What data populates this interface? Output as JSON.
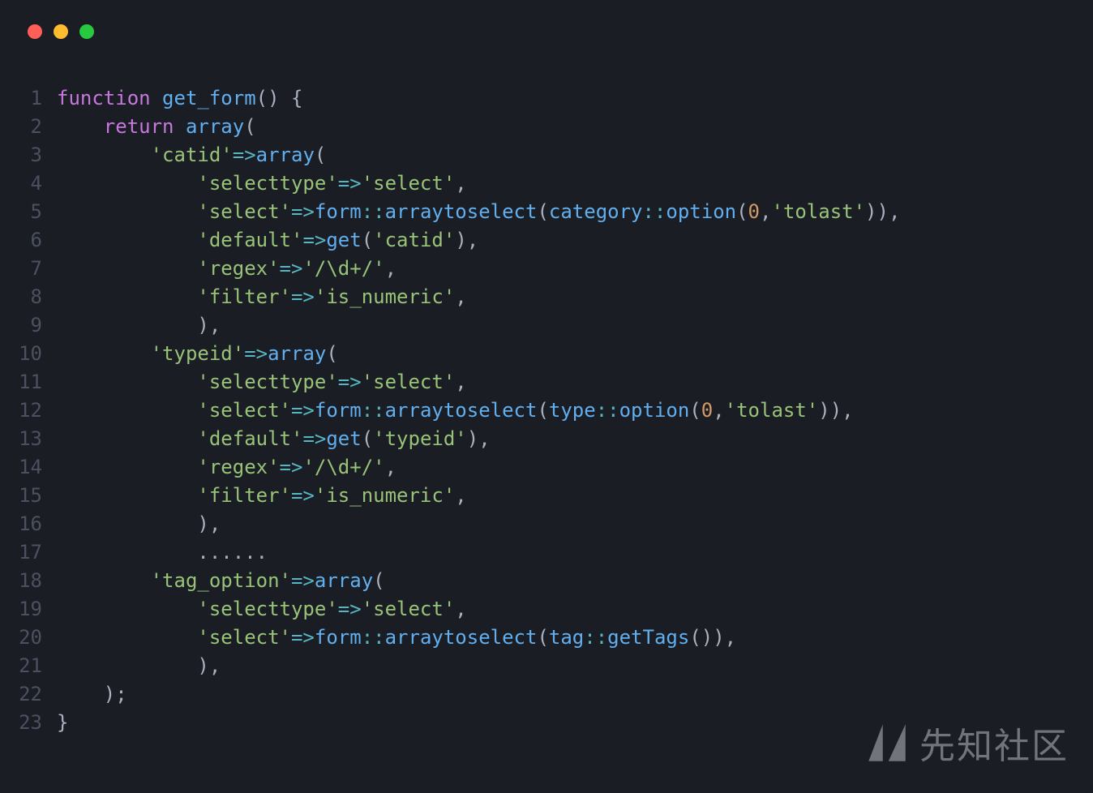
{
  "window": {
    "traffic": [
      "close",
      "minimize",
      "zoom"
    ]
  },
  "watermark": {
    "text": "先知社区"
  },
  "code": {
    "lines": [
      {
        "n": "1",
        "tokens": [
          {
            "t": "function ",
            "c": "kw"
          },
          {
            "t": "get_form",
            "c": "fn"
          },
          {
            "t": "() {",
            "c": "punct"
          }
        ]
      },
      {
        "n": "2",
        "tokens": [
          {
            "t": "    ",
            "c": "plain"
          },
          {
            "t": "return ",
            "c": "kw"
          },
          {
            "t": "array",
            "c": "fn"
          },
          {
            "t": "(",
            "c": "punct"
          }
        ]
      },
      {
        "n": "3",
        "tokens": [
          {
            "t": "        ",
            "c": "plain"
          },
          {
            "t": "'catid'",
            "c": "str"
          },
          {
            "t": "=>",
            "c": "op"
          },
          {
            "t": "array",
            "c": "fn"
          },
          {
            "t": "(",
            "c": "punct"
          }
        ]
      },
      {
        "n": "4",
        "tokens": [
          {
            "t": "            ",
            "c": "plain"
          },
          {
            "t": "'selecttype'",
            "c": "str"
          },
          {
            "t": "=>",
            "c": "op"
          },
          {
            "t": "'select'",
            "c": "str"
          },
          {
            "t": ",",
            "c": "punct"
          }
        ]
      },
      {
        "n": "5",
        "tokens": [
          {
            "t": "            ",
            "c": "plain"
          },
          {
            "t": "'select'",
            "c": "str"
          },
          {
            "t": "=>",
            "c": "op"
          },
          {
            "t": "form",
            "c": "fn"
          },
          {
            "t": "::",
            "c": "op"
          },
          {
            "t": "arraytoselect",
            "c": "fn"
          },
          {
            "t": "(",
            "c": "punct"
          },
          {
            "t": "category",
            "c": "fn"
          },
          {
            "t": "::",
            "c": "op"
          },
          {
            "t": "option",
            "c": "fn"
          },
          {
            "t": "(",
            "c": "punct"
          },
          {
            "t": "0",
            "c": "num"
          },
          {
            "t": ",",
            "c": "punct"
          },
          {
            "t": "'tolast'",
            "c": "str"
          },
          {
            "t": ")),",
            "c": "punct"
          }
        ]
      },
      {
        "n": "6",
        "tokens": [
          {
            "t": "            ",
            "c": "plain"
          },
          {
            "t": "'default'",
            "c": "str"
          },
          {
            "t": "=>",
            "c": "op"
          },
          {
            "t": "get",
            "c": "fn"
          },
          {
            "t": "(",
            "c": "punct"
          },
          {
            "t": "'catid'",
            "c": "str"
          },
          {
            "t": "),",
            "c": "punct"
          }
        ]
      },
      {
        "n": "7",
        "tokens": [
          {
            "t": "            ",
            "c": "plain"
          },
          {
            "t": "'regex'",
            "c": "str"
          },
          {
            "t": "=>",
            "c": "op"
          },
          {
            "t": "'/\\d+/'",
            "c": "str"
          },
          {
            "t": ",",
            "c": "punct"
          }
        ]
      },
      {
        "n": "8",
        "tokens": [
          {
            "t": "            ",
            "c": "plain"
          },
          {
            "t": "'filter'",
            "c": "str"
          },
          {
            "t": "=>",
            "c": "op"
          },
          {
            "t": "'is_numeric'",
            "c": "str"
          },
          {
            "t": ",",
            "c": "punct"
          }
        ]
      },
      {
        "n": "9",
        "tokens": [
          {
            "t": "            ",
            "c": "plain"
          },
          {
            "t": "),",
            "c": "punct"
          }
        ]
      },
      {
        "n": "10",
        "tokens": [
          {
            "t": "        ",
            "c": "plain"
          },
          {
            "t": "'typeid'",
            "c": "str"
          },
          {
            "t": "=>",
            "c": "op"
          },
          {
            "t": "array",
            "c": "fn"
          },
          {
            "t": "(",
            "c": "punct"
          }
        ]
      },
      {
        "n": "11",
        "tokens": [
          {
            "t": "            ",
            "c": "plain"
          },
          {
            "t": "'selecttype'",
            "c": "str"
          },
          {
            "t": "=>",
            "c": "op"
          },
          {
            "t": "'select'",
            "c": "str"
          },
          {
            "t": ",",
            "c": "punct"
          }
        ]
      },
      {
        "n": "12",
        "tokens": [
          {
            "t": "            ",
            "c": "plain"
          },
          {
            "t": "'select'",
            "c": "str"
          },
          {
            "t": "=>",
            "c": "op"
          },
          {
            "t": "form",
            "c": "fn"
          },
          {
            "t": "::",
            "c": "op"
          },
          {
            "t": "arraytoselect",
            "c": "fn"
          },
          {
            "t": "(",
            "c": "punct"
          },
          {
            "t": "type",
            "c": "fn"
          },
          {
            "t": "::",
            "c": "op"
          },
          {
            "t": "option",
            "c": "fn"
          },
          {
            "t": "(",
            "c": "punct"
          },
          {
            "t": "0",
            "c": "num"
          },
          {
            "t": ",",
            "c": "punct"
          },
          {
            "t": "'tolast'",
            "c": "str"
          },
          {
            "t": ")),",
            "c": "punct"
          }
        ]
      },
      {
        "n": "13",
        "tokens": [
          {
            "t": "            ",
            "c": "plain"
          },
          {
            "t": "'default'",
            "c": "str"
          },
          {
            "t": "=>",
            "c": "op"
          },
          {
            "t": "get",
            "c": "fn"
          },
          {
            "t": "(",
            "c": "punct"
          },
          {
            "t": "'typeid'",
            "c": "str"
          },
          {
            "t": "),",
            "c": "punct"
          }
        ]
      },
      {
        "n": "14",
        "tokens": [
          {
            "t": "            ",
            "c": "plain"
          },
          {
            "t": "'regex'",
            "c": "str"
          },
          {
            "t": "=>",
            "c": "op"
          },
          {
            "t": "'/\\d+/'",
            "c": "str"
          },
          {
            "t": ",",
            "c": "punct"
          }
        ]
      },
      {
        "n": "15",
        "tokens": [
          {
            "t": "            ",
            "c": "plain"
          },
          {
            "t": "'filter'",
            "c": "str"
          },
          {
            "t": "=>",
            "c": "op"
          },
          {
            "t": "'is_numeric'",
            "c": "str"
          },
          {
            "t": ",",
            "c": "punct"
          }
        ]
      },
      {
        "n": "16",
        "tokens": [
          {
            "t": "            ",
            "c": "plain"
          },
          {
            "t": "),",
            "c": "punct"
          }
        ]
      },
      {
        "n": "17",
        "tokens": [
          {
            "t": "            ",
            "c": "plain"
          },
          {
            "t": "......",
            "c": "punct"
          }
        ]
      },
      {
        "n": "18",
        "tokens": [
          {
            "t": "        ",
            "c": "plain"
          },
          {
            "t": "'tag_option'",
            "c": "str"
          },
          {
            "t": "=>",
            "c": "op"
          },
          {
            "t": "array",
            "c": "fn"
          },
          {
            "t": "(",
            "c": "punct"
          }
        ]
      },
      {
        "n": "19",
        "tokens": [
          {
            "t": "            ",
            "c": "plain"
          },
          {
            "t": "'selecttype'",
            "c": "str"
          },
          {
            "t": "=>",
            "c": "op"
          },
          {
            "t": "'select'",
            "c": "str"
          },
          {
            "t": ",",
            "c": "punct"
          }
        ]
      },
      {
        "n": "20",
        "tokens": [
          {
            "t": "            ",
            "c": "plain"
          },
          {
            "t": "'select'",
            "c": "str"
          },
          {
            "t": "=>",
            "c": "op"
          },
          {
            "t": "form",
            "c": "fn"
          },
          {
            "t": "::",
            "c": "op"
          },
          {
            "t": "arraytoselect",
            "c": "fn"
          },
          {
            "t": "(",
            "c": "punct"
          },
          {
            "t": "tag",
            "c": "fn"
          },
          {
            "t": "::",
            "c": "op"
          },
          {
            "t": "getTags",
            "c": "fn"
          },
          {
            "t": "()),",
            "c": "punct"
          }
        ]
      },
      {
        "n": "21",
        "tokens": [
          {
            "t": "            ",
            "c": "plain"
          },
          {
            "t": "),",
            "c": "punct"
          }
        ]
      },
      {
        "n": "22",
        "tokens": [
          {
            "t": "    ",
            "c": "plain"
          },
          {
            "t": ");",
            "c": "punct"
          }
        ]
      },
      {
        "n": "23",
        "tokens": [
          {
            "t": "}",
            "c": "punct"
          }
        ]
      }
    ]
  }
}
